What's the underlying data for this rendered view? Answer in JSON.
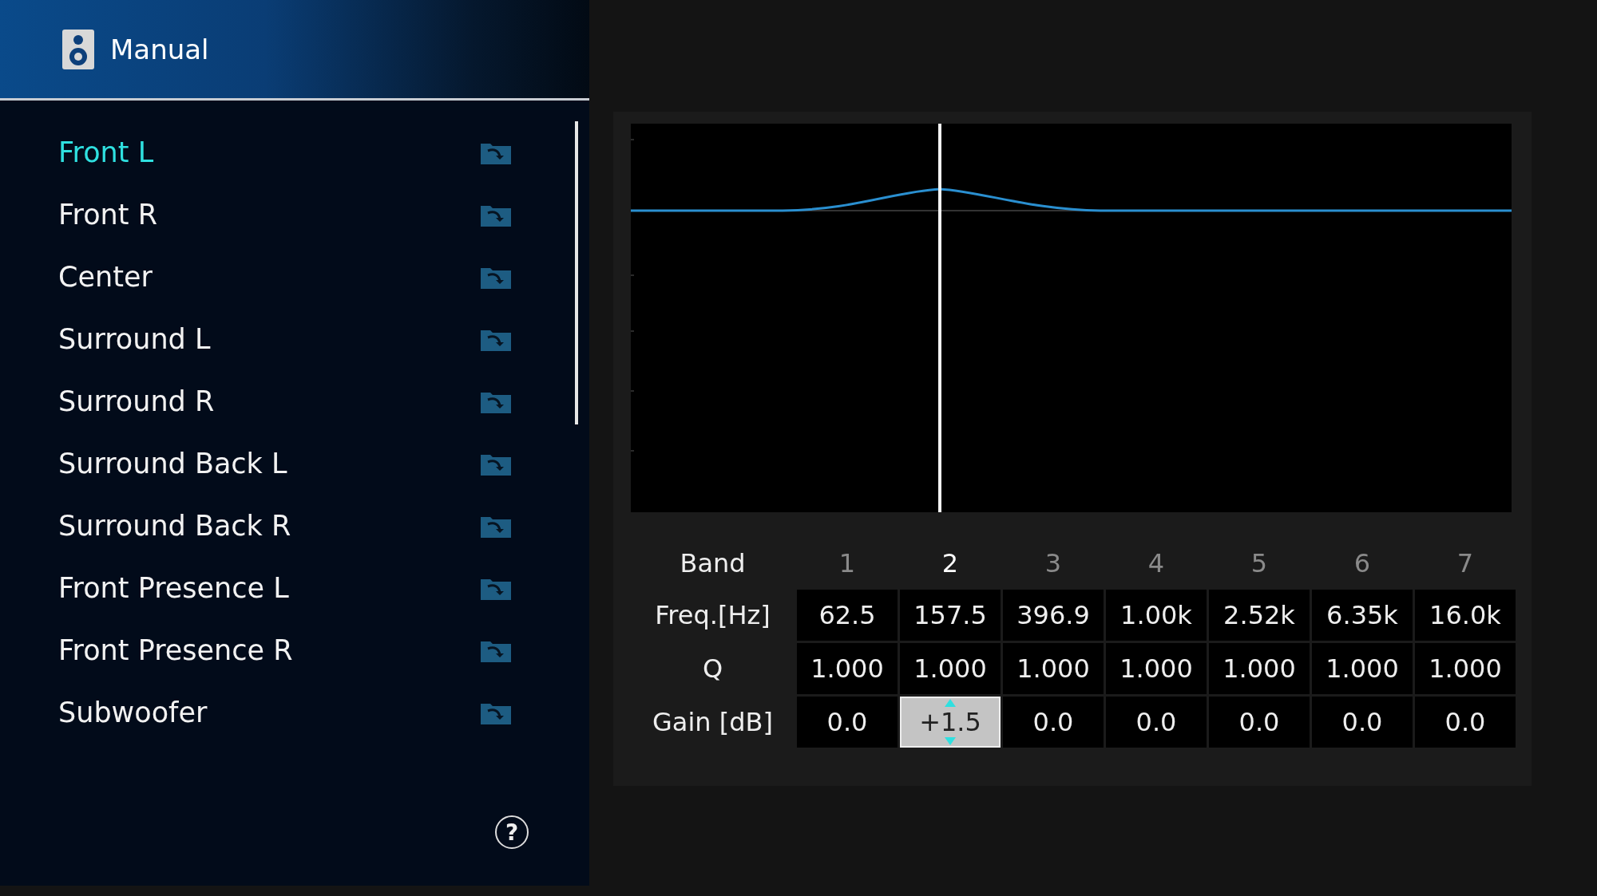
{
  "header": {
    "title": "Manual"
  },
  "channels": [
    {
      "label": "Front L",
      "selected": true
    },
    {
      "label": "Front R",
      "selected": false
    },
    {
      "label": "Center",
      "selected": false
    },
    {
      "label": "Surround L",
      "selected": false
    },
    {
      "label": "Surround R",
      "selected": false
    },
    {
      "label": "Surround Back L",
      "selected": false
    },
    {
      "label": "Surround Back R",
      "selected": false
    },
    {
      "label": "Front Presence L",
      "selected": false
    },
    {
      "label": "Front Presence R",
      "selected": false
    },
    {
      "label": "Subwoofer",
      "selected": false
    }
  ],
  "help": "?",
  "eq": {
    "row_labels": {
      "band": "Band",
      "freq": "Freq.[Hz]",
      "q": "Q",
      "gain": "Gain [dB]"
    },
    "bands": [
      {
        "number": "1",
        "freq": "62.5",
        "q": "1.000",
        "gain": "0.0",
        "selected": false
      },
      {
        "number": "2",
        "freq": "157.5",
        "q": "1.000",
        "gain": "+1.5",
        "selected": true
      },
      {
        "number": "3",
        "freq": "396.9",
        "q": "1.000",
        "gain": "0.0",
        "selected": false
      },
      {
        "number": "4",
        "freq": "1.00k",
        "q": "1.000",
        "gain": "0.0",
        "selected": false
      },
      {
        "number": "5",
        "freq": "2.52k",
        "q": "1.000",
        "gain": "0.0",
        "selected": false
      },
      {
        "number": "6",
        "freq": "6.35k",
        "q": "1.000",
        "gain": "0.0",
        "selected": false
      },
      {
        "number": "7",
        "freq": "16.0k",
        "q": "1.000",
        "gain": "0.0",
        "selected": false
      }
    ]
  }
}
